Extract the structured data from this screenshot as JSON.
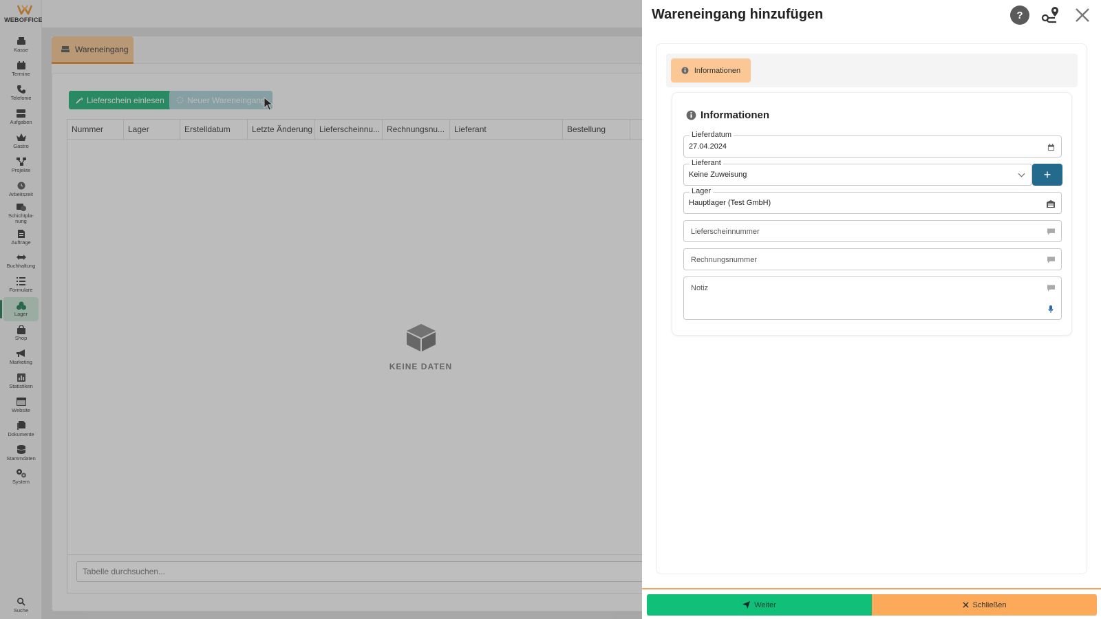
{
  "app": {
    "logo_text": "WEBOFFICE"
  },
  "sidebar": {
    "items": [
      {
        "label": "Kasse",
        "icon": "register-icon"
      },
      {
        "label": "Termine",
        "icon": "calendar-icon"
      },
      {
        "label": "Telefonie",
        "icon": "phone-icon"
      },
      {
        "label": "Aufgaben",
        "icon": "tasks-icon"
      },
      {
        "label": "Gastro",
        "icon": "crown-icon"
      },
      {
        "label": "Projekte",
        "icon": "projects-icon"
      },
      {
        "label": "Arbeitszeit",
        "icon": "clock-icon"
      },
      {
        "label": "Schichtpla-\nnung",
        "icon": "shift-calendar-icon"
      },
      {
        "label": "Aufträge",
        "icon": "document-icon"
      },
      {
        "label": "Buchhaltung",
        "icon": "arrows-icon"
      },
      {
        "label": "Formulare",
        "icon": "list-icon"
      },
      {
        "label": "Lager",
        "icon": "boxes-icon",
        "active": true
      },
      {
        "label": "Shop",
        "icon": "bag-icon"
      },
      {
        "label": "Marketing",
        "icon": "megaphone-icon"
      },
      {
        "label": "Statistiken",
        "icon": "chart-icon"
      },
      {
        "label": "Website",
        "icon": "browser-icon"
      },
      {
        "label": "Dokumente",
        "icon": "files-icon"
      },
      {
        "label": "Stammdaten",
        "icon": "database-icon"
      },
      {
        "label": "System",
        "icon": "gears-icon"
      }
    ],
    "search_label": "Suche"
  },
  "main": {
    "tab_label": "Wareneingang",
    "btn_import": "Lieferschein einlesen",
    "btn_new": "Neuer Wareneingang",
    "columns": [
      "Nummer",
      "Lager",
      "Erstelldatum",
      "Letzte Änderung",
      "Lieferscheinnu...",
      "Rechnungsnu...",
      "Lieferant",
      "Bestellung"
    ],
    "empty_text": "KEINE DATEN",
    "search_placeholder": "Tabelle durchsuchen..."
  },
  "modal": {
    "title": "Wareneingang hinzufügen",
    "help_label": "?",
    "section_tab": "Informationen",
    "section_title": "Informationen",
    "fields": {
      "lieferdatum_label": "Lieferdatum",
      "lieferdatum_value": "27.04.2024",
      "lieferant_label": "Lieferant",
      "lieferant_value": "Keine Zuweisung",
      "lager_label": "Lager",
      "lager_value": "Hauptlager (Test GmbH)",
      "lieferscheinnummer_placeholder": "Lieferscheinnummer",
      "rechnungsnummer_placeholder": "Rechnungsnummer",
      "notiz_placeholder": "Notiz"
    },
    "btn_next": "Weiter",
    "btn_close": "Schließen"
  },
  "colors": {
    "accent_green": "#10c078",
    "accent_orange": "#fcaa5a",
    "accent_blue": "#246a8c"
  }
}
